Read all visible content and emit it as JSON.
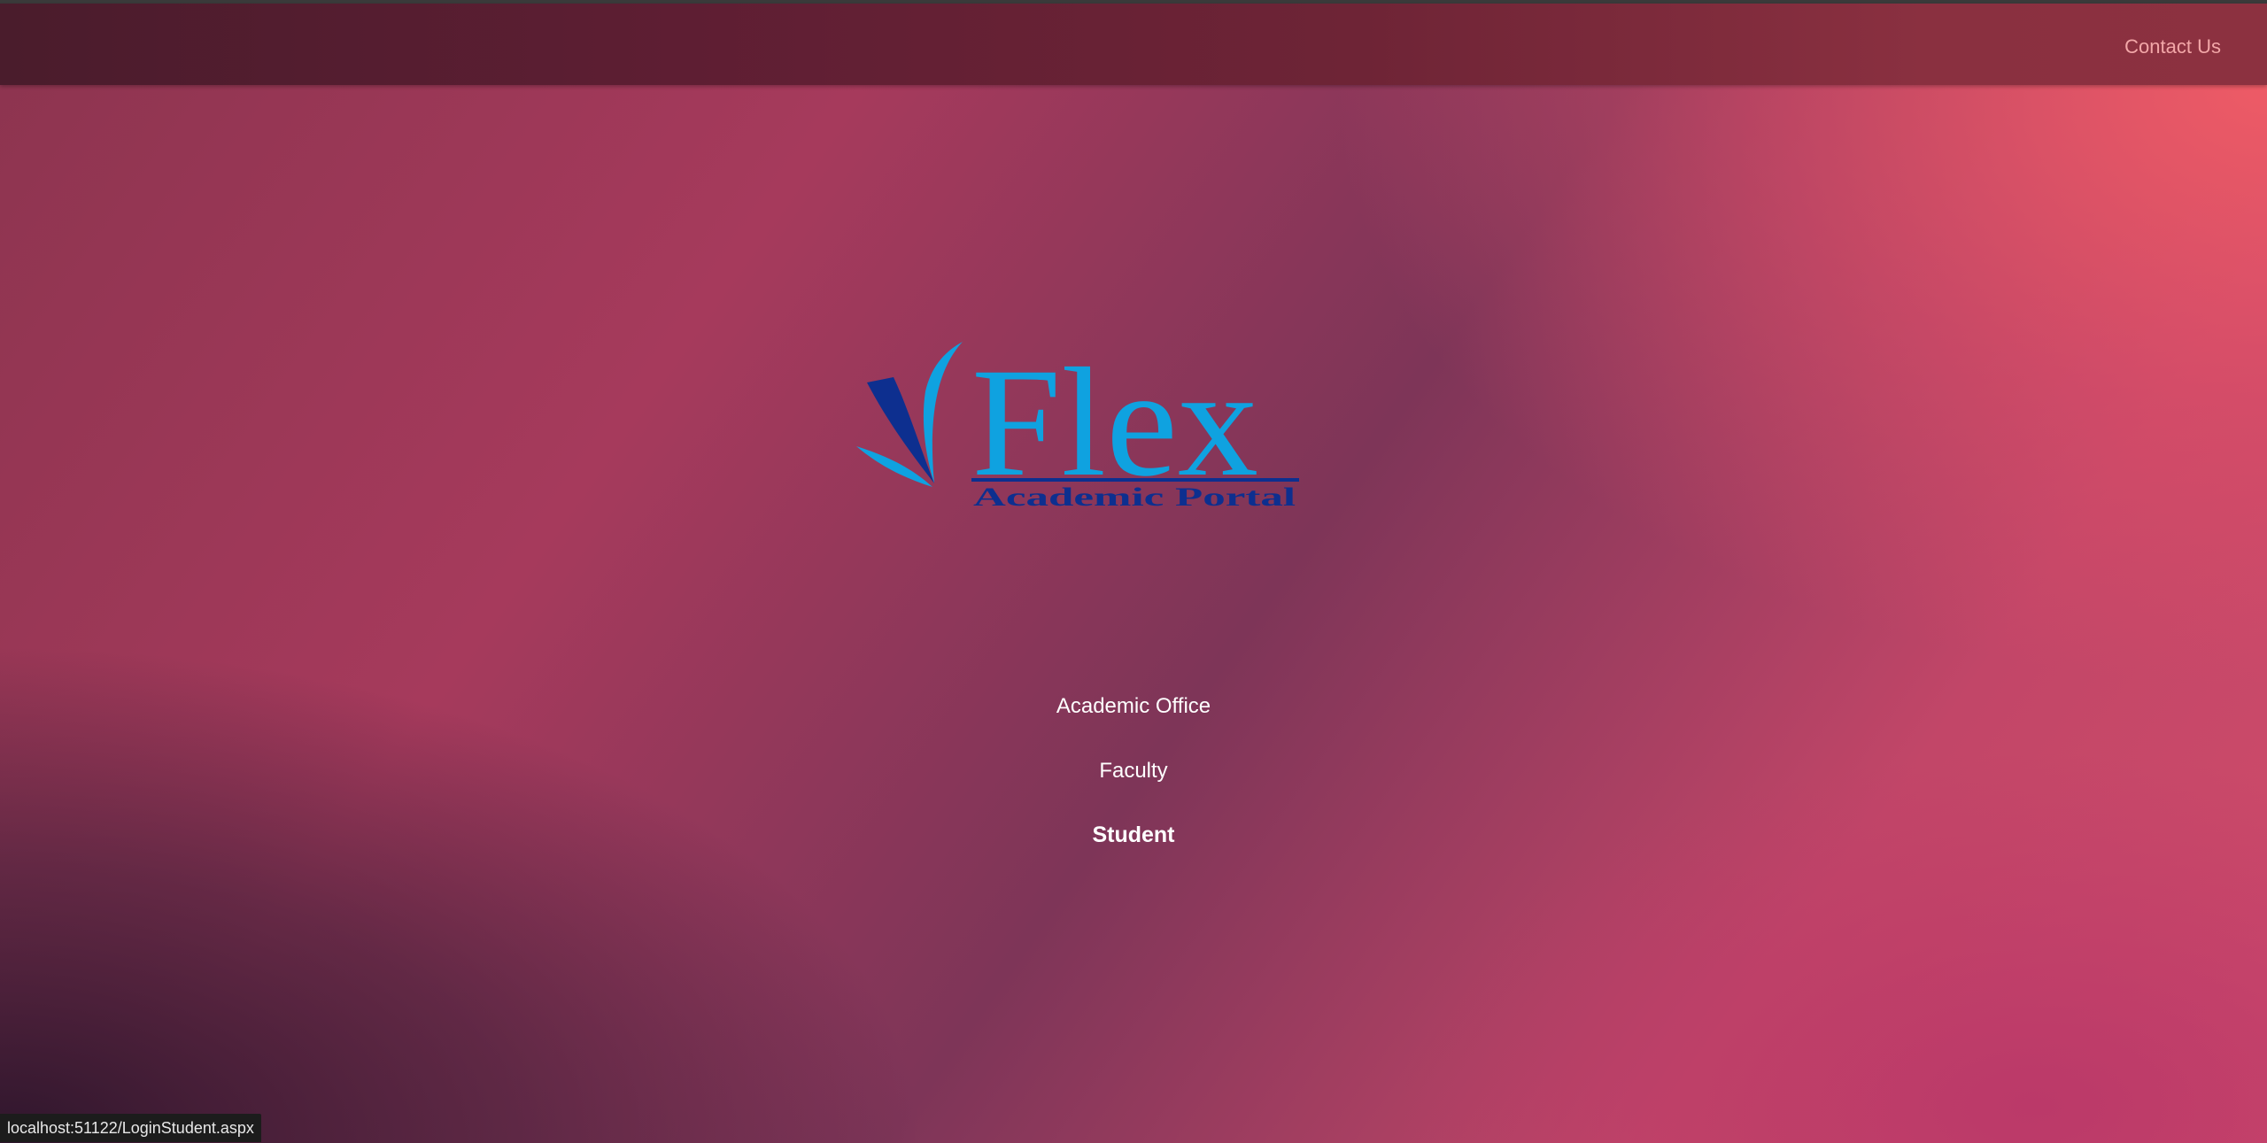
{
  "nav": {
    "contact_label": "Contact Us"
  },
  "logo": {
    "title": "Flex",
    "subtitle": "Academic Portal"
  },
  "menu": {
    "items": [
      {
        "label": "Academic Office"
      },
      {
        "label": "Faculty"
      },
      {
        "label": "Student"
      }
    ]
  },
  "status_bar": {
    "url": "localhost:51122/LoginStudent.aspx"
  },
  "colors": {
    "logo_blue": "#0fa2e0",
    "logo_dark_blue": "#0d2f8f",
    "contact_link": "#f3a7a8"
  }
}
